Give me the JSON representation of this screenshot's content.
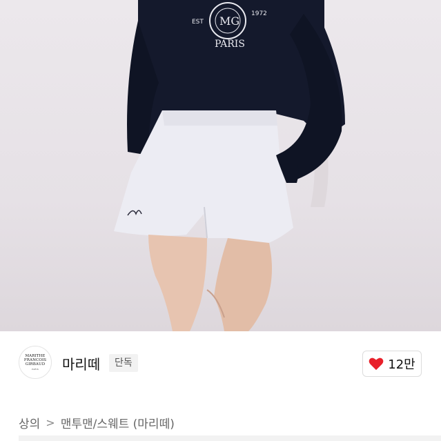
{
  "product": {
    "image_alt": "model wearing navy sweatshirt and white shorts",
    "shirt_print": {
      "emblem": "MG",
      "ring_text": "MARITHE FRANCOIS GIRBAUD",
      "est": "EST",
      "year": "1972",
      "city": "PARIS"
    }
  },
  "brand": {
    "logo_text_1": "MARITHE",
    "logo_text_2": "FRANCOIS",
    "logo_text_3": "GIRBAUD",
    "logo_sub": "PARIS",
    "name": "마리떼",
    "badge": "단독"
  },
  "like": {
    "count": "12만",
    "icon": "heart-icon",
    "color": "#e8202a"
  },
  "breadcrumb": {
    "level1": "상의",
    "separator": ">",
    "level2": "맨투맨/스웨트 (마리떼)"
  }
}
